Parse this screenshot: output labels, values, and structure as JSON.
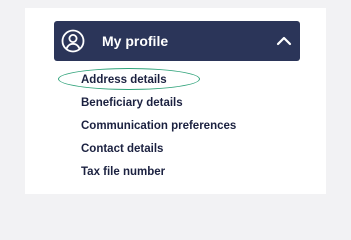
{
  "header": {
    "title": "My profile",
    "icon": "user-circle-icon",
    "toggle_icon": "chevron-up-icon",
    "background_color": "#2b3559"
  },
  "menu": {
    "items": [
      {
        "label": "Address details"
      },
      {
        "label": "Beneficiary details"
      },
      {
        "label": "Communication preferences"
      },
      {
        "label": "Contact details"
      },
      {
        "label": "Tax file number"
      }
    ],
    "highlight_color": "#2fa37a",
    "highlighted_item": "Address details"
  }
}
